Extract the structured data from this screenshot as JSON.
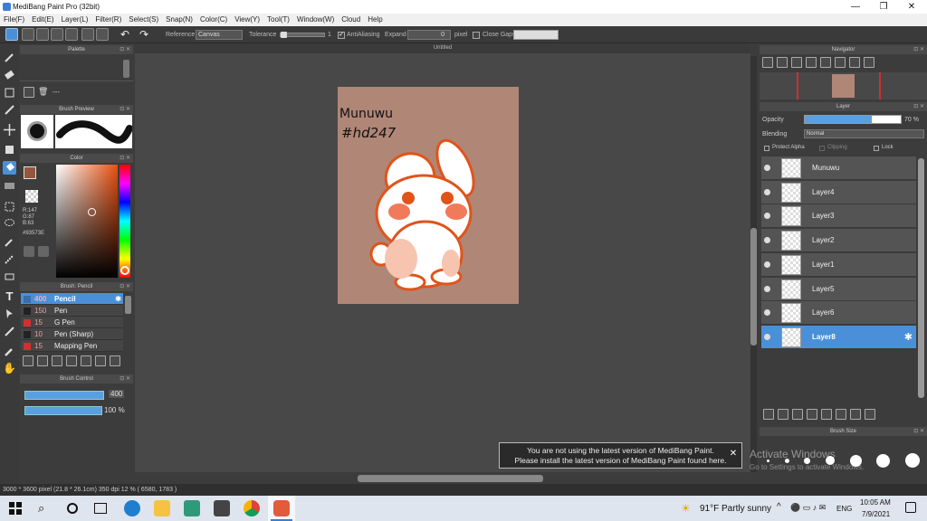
{
  "window": {
    "title": "MediBang Paint Pro (32bit)",
    "min": "—",
    "max": "❐",
    "close": "✕"
  },
  "menu": [
    "File(F)",
    "Edit(E)",
    "Layer(L)",
    "Filter(R)",
    "Select(S)",
    "Snap(N)",
    "Color(C)",
    "View(Y)",
    "Tool(T)",
    "Window(W)",
    "Cloud",
    "Help"
  ],
  "toolbar": {
    "reference_label": "Reference",
    "reference_value": "Canvas",
    "tolerance_label": "Tolerance",
    "tolerance_value": "1",
    "antialias_label": "AntiAliasing",
    "expand_label": "Expand",
    "expand_value": "0",
    "expand_unit": "pixel",
    "closegap_label": "Close Gaps"
  },
  "palette": {
    "title": "Palette",
    "value": "---"
  },
  "brush_preview": {
    "title": "Brush Preview"
  },
  "color": {
    "title": "Color",
    "r": "R:147",
    "g": "G:87",
    "b": "B:63",
    "hex": "#93573E",
    "main": "#93573e"
  },
  "brush_panel": {
    "title": "Brush: Pencil",
    "items": [
      {
        "size": "400",
        "name": "Pencil",
        "color": "#3a6ea5",
        "selected": true
      },
      {
        "size": "150",
        "name": "Pen",
        "color": "#222222",
        "selected": false
      },
      {
        "size": "15",
        "name": "G Pen",
        "color": "#d03030",
        "selected": false
      },
      {
        "size": "10",
        "name": "Pen (Sharp)",
        "color": "#222222",
        "selected": false
      },
      {
        "size": "15",
        "name": "Mapping Pen",
        "color": "#d03030",
        "selected": false
      }
    ]
  },
  "brush_control": {
    "title": "Brush Control",
    "size": "400",
    "opacity": "100 %"
  },
  "document": {
    "tab": "Untitled",
    "text1": "Munuwu",
    "text2": "#hd247"
  },
  "navigator": {
    "title": "Navigator"
  },
  "layer": {
    "title": "Layer",
    "opacity_label": "Opacity",
    "opacity_value": "70 %",
    "blending_label": "Blending",
    "blending_value": "Normal",
    "protect_alpha": "Protect Alpha",
    "clipping": "Clipping",
    "lock": "Lock",
    "items": [
      "Munuwu",
      "Layer4",
      "Layer3",
      "Layer2",
      "Layer1",
      "Layer5",
      "Layer6",
      "Layer8"
    ]
  },
  "brush_size": {
    "title": "Brush Size"
  },
  "notice": {
    "line1": "You are not using the latest version of MediBang Paint.",
    "line2": "Please install the latest version of MediBang Paint found here.",
    "close": "✕"
  },
  "watermark": {
    "line1": "Activate Windows",
    "line2": "Go to Settings to activate Windows."
  },
  "status": {
    "text": "3000 * 3600 pixel  (21.8 * 26.1cm)  350 dpi  12 %  ( 6580, 1783 )"
  },
  "taskbar": {
    "weather": "91°F  Partly sunny",
    "lang": "ENG",
    "time": "10:05 AM",
    "date": "7/9/2021"
  }
}
